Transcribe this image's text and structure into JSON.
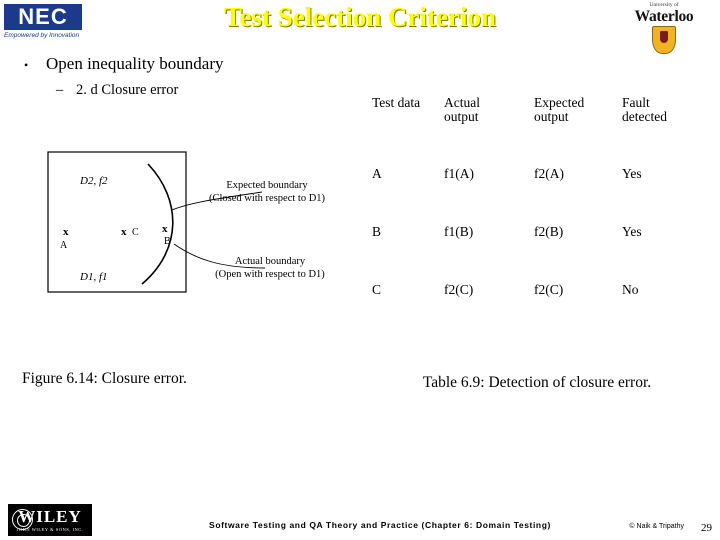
{
  "header": {
    "title": "Test Selection Criterion",
    "nec_logo": "NEC",
    "nec_tagline": "Empowered by Innovation",
    "uw_sub": "University of",
    "uw_name": "Waterloo"
  },
  "bullets": {
    "level1": "Open inequality boundary",
    "level2": "2. d Closure error"
  },
  "figure": {
    "caption": "Figure 6.14: Closure error.",
    "label_d2": "D2,  f2",
    "label_d1": "D1,  f1",
    "point_a": "A",
    "point_b": "B",
    "point_c": "C",
    "x_a": "x",
    "x_b": "x",
    "x_c": "x",
    "expected_boundary_line1": "Expected boundary",
    "expected_boundary_line2": "(Closed with respect to D1)",
    "actual_boundary_line1": "Actual boundary",
    "actual_boundary_line2": "(Open with respect to D1)"
  },
  "table": {
    "caption": "Table 6.9: Detection of closure error.",
    "headers": [
      [
        "Test data",
        ""
      ],
      [
        "Actual",
        "output"
      ],
      [
        "Expected",
        "output"
      ],
      [
        "Fault",
        "detected"
      ]
    ],
    "rows": [
      [
        "A",
        "f1(A)",
        "f2(A)",
        "Yes"
      ],
      [
        "B",
        "f1(B)",
        "f2(B)",
        "Yes"
      ],
      [
        "C",
        "f2(C)",
        "f2(C)",
        "No"
      ]
    ]
  },
  "footer": {
    "wiley_name": "WILEY",
    "wiley_sub": "JOHN WILEY & SONS, INC.",
    "center_text": "Software Testing and QA Theory and Practice (Chapter 6: Domain Testing)",
    "right_text": "© Naik & Tripathy",
    "slide_number": "29"
  }
}
